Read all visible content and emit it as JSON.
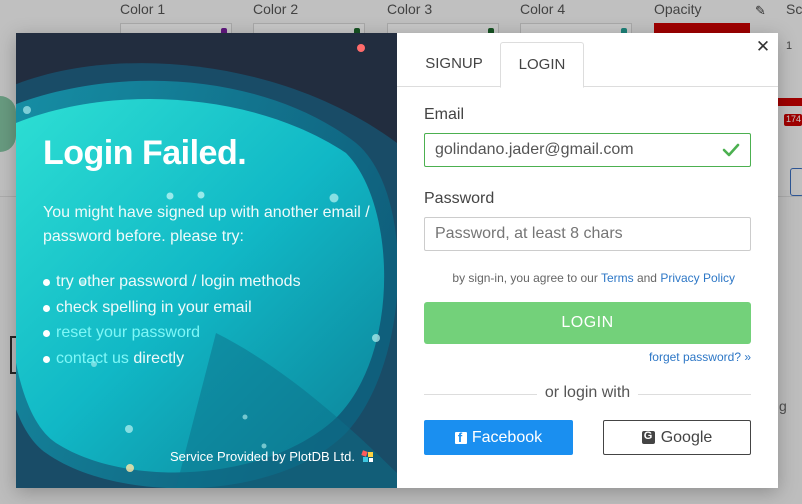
{
  "background": {
    "color_labels": [
      "Color 1",
      "Color 2",
      "Color 3",
      "Color 4"
    ],
    "color_dots": [
      "#7b1fa2",
      "#1e6b2e",
      "#1e6b2e",
      "#26a69a"
    ],
    "opacity_label": "Opacity",
    "right_label_1": "Sc",
    "right_label_2": "1",
    "right_badge": "174",
    "right_letter": "g"
  },
  "modal": {
    "left": {
      "title": "Login Failed.",
      "description": "You might have signed up with another email / password before. please try:",
      "tips": [
        {
          "text": "try other password / login methods",
          "link": false
        },
        {
          "text": "check spelling in your email",
          "link": false
        },
        {
          "text": "reset your password",
          "link": true
        },
        {
          "link_text": "contact us",
          "suffix": " directly"
        }
      ],
      "service": "Service Provided by PlotDB Ltd."
    },
    "tabs": [
      "SIGNUP",
      "LOGIN"
    ],
    "active_tab": "LOGIN",
    "email_label": "Email",
    "email_value": "golindano.jader@gmail.com",
    "password_label": "Password",
    "password_placeholder": "Password, at least 8 chars",
    "agree_prefix": "by sign-in, you agree to our ",
    "terms": "Terms",
    "agree_and": " and ",
    "privacy": "Privacy Policy",
    "login_button": "LOGIN",
    "forget_password": "forget password? »",
    "or_login_with": "or login with",
    "facebook_button": "Facebook",
    "google_button": "Google",
    "close_glyph": "✕"
  },
  "colors": {
    "panel_dark": "#222d3f",
    "teal": "#11b8c6",
    "login_green": "#73d17a",
    "facebook_blue": "#1a8ff0",
    "link_blue": "#2d77c6",
    "valid_green": "#4cb050"
  }
}
